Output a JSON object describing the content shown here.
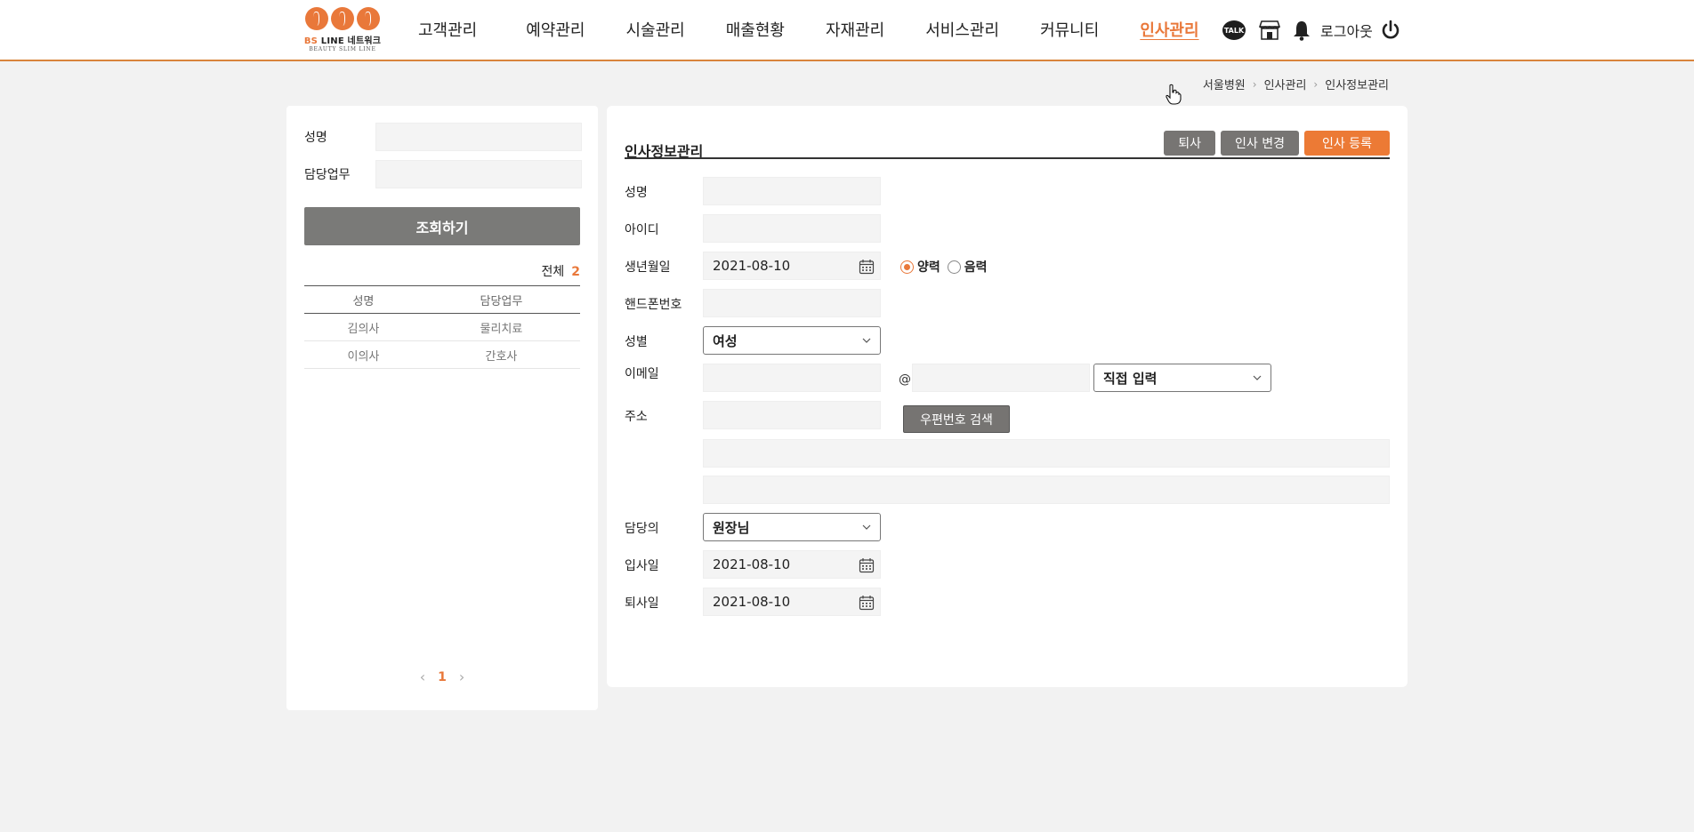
{
  "header": {
    "logo": {
      "brand_bs": "BS",
      "brand_rest": "LINE 네트워크",
      "tagline": "BEAUTY SLIM LINE"
    },
    "nav": [
      {
        "label": "고객관리",
        "active": false
      },
      {
        "label": "예약관리",
        "active": false
      },
      {
        "label": "시술관리",
        "active": false
      },
      {
        "label": "매출현황",
        "active": false
      },
      {
        "label": "자재관리",
        "active": false
      },
      {
        "label": "서비스관리",
        "active": false
      },
      {
        "label": "커뮤니티",
        "active": false
      },
      {
        "label": "인사관리",
        "active": true
      }
    ],
    "talk_label": "TALK",
    "logout_label": "로그아웃"
  },
  "breadcrumb": [
    "서울병원",
    "인사관리",
    "인사정보관리"
  ],
  "left_panel": {
    "name_label": "성명",
    "duty_label": "담당업무",
    "search_button": "조회하기",
    "total_label": "전체",
    "total_count": "2",
    "table": {
      "headers": [
        "성명",
        "담당업무"
      ],
      "rows": [
        [
          "김의사",
          "물리치료"
        ],
        [
          "이의사",
          "간호사"
        ]
      ]
    },
    "pagination": {
      "current": "1",
      "prev": "‹",
      "next": "›"
    }
  },
  "right_panel": {
    "title": "인사정보관리",
    "buttons": {
      "resign": "퇴사",
      "change": "인사 변경",
      "register": "인사 등록"
    },
    "fields": {
      "name_label": "성명",
      "id_label": "아이디",
      "birth_label": "생년월일",
      "birth_value": "2021-08-10",
      "solar_label": "양력",
      "lunar_label": "음력",
      "phone_label": "핸드폰번호",
      "gender_label": "성별",
      "gender_value": "여성",
      "email_label": "이메일",
      "email_at": "@",
      "email_domain_value": "직접 입력",
      "address_label": "주소",
      "zip_button": "우편번호 검색",
      "doctor_label": "담당의",
      "doctor_value": "원장님",
      "join_label": "입사일",
      "join_value": "2021-08-10",
      "leave_label": "퇴사일",
      "leave_value": "2021-08-10"
    }
  },
  "colors": {
    "accent": "#e9783a",
    "button_gray": "#777573"
  }
}
